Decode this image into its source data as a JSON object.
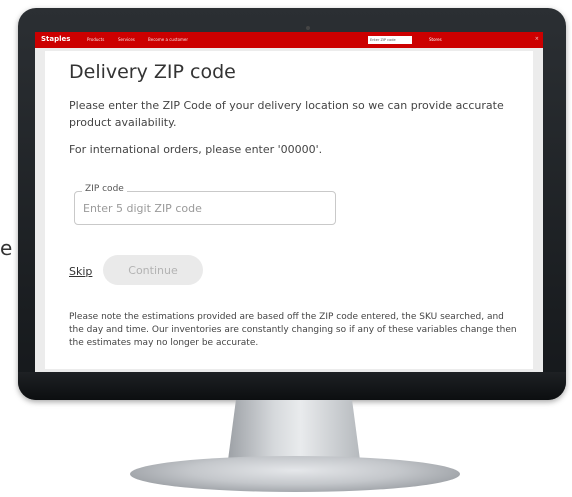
{
  "side_glyph": "e",
  "topbar": {
    "logo": "Staples",
    "nav": [
      "Products",
      "Services",
      "Become a customer"
    ],
    "search_value": "Enter ZIP code",
    "stores": "Stores",
    "corner": "×"
  },
  "modal": {
    "title": "Delivery ZIP code",
    "description": "Please enter the ZIP Code of your delivery location so we can provide accurate product availability.",
    "international": "For international orders, please enter '00000'.",
    "zip": {
      "label": "ZIP code",
      "placeholder": "Enter 5 digit ZIP code",
      "value": ""
    },
    "skip_label": "Skip",
    "continue_label": "Continue",
    "note": "Please note the estimations provided are based off the ZIP code entered, the SKU searched, and the day and time. Our inventories are constantly changing so if any of these variables change then the estimates may no longer be accurate."
  },
  "colors": {
    "brand_red": "#cc0000",
    "bezel": "#1b1e21",
    "button_disabled_bg": "#eaeaea",
    "button_disabled_text": "#b3b3b3"
  }
}
